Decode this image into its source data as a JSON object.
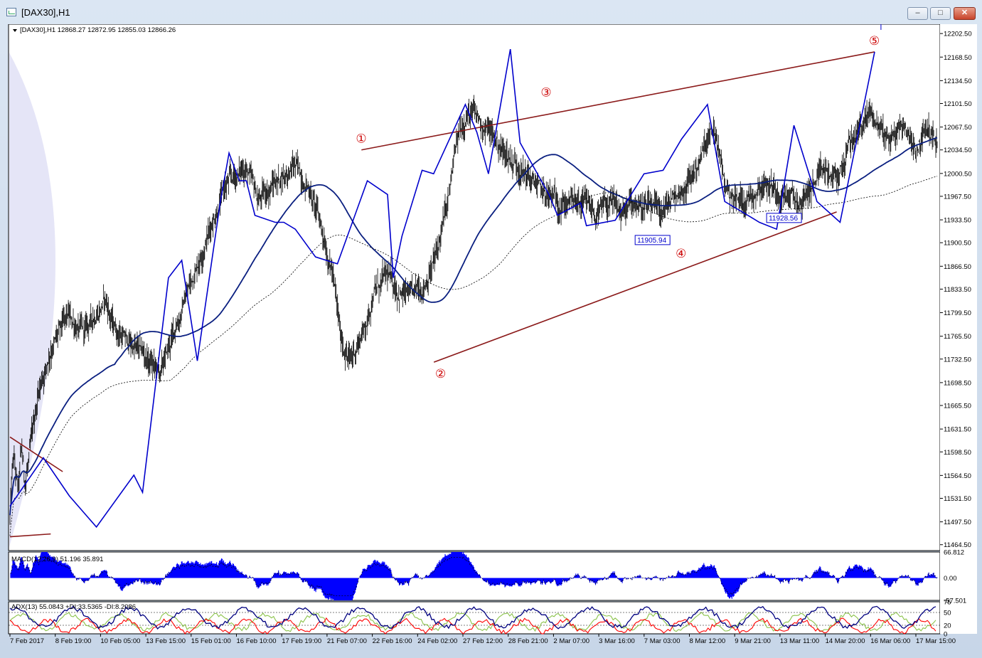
{
  "window": {
    "title": "[DAX30],H1",
    "min_glyph": "‒",
    "max_glyph": "□",
    "close_glyph": "✕"
  },
  "chart_data": {
    "type": "candlestick",
    "symbol_info": "[DAX30],H1  12868.27 12872.95 12855.03 12866.26",
    "y_ticks": [
      "12202.50",
      "12168.50",
      "12134.50",
      "12101.50",
      "12067.50",
      "12034.50",
      "12000.50",
      "11967.50",
      "11933.50",
      "11900.50",
      "11866.50",
      "11833.50",
      "11799.50",
      "11765.50",
      "11732.50",
      "11698.50",
      "11665.50",
      "11631.50",
      "11598.50",
      "11564.50",
      "11531.50",
      "11497.50",
      "11464.50"
    ],
    "x_ticks": [
      "7 Feb 2017",
      "8 Feb 19:00",
      "10 Feb 05:00",
      "13 Feb 15:00",
      "15 Feb 01:00",
      "16 Feb 10:00",
      "17 Feb 19:00",
      "21 Feb 07:00",
      "22 Feb 16:00",
      "24 Feb 02:00",
      "27 Feb 12:00",
      "28 Feb 21:00",
      "2 Mar 07:00",
      "3 Mar 16:00",
      "7 Mar 03:00",
      "8 Mar 12:00",
      "9 Mar 21:00",
      "13 Mar 11:00",
      "14 Mar 20:00",
      "16 Mar 06:00",
      "17 Mar 15:00"
    ],
    "ylim": [
      11456,
      12216
    ],
    "price_path": [
      [
        0,
        11505
      ],
      [
        4,
        11590
      ],
      [
        10,
        11540
      ],
      [
        14,
        11600
      ],
      [
        18,
        11552
      ],
      [
        25,
        11600
      ],
      [
        35,
        11690
      ],
      [
        50,
        11750
      ],
      [
        70,
        11790
      ],
      [
        90,
        11770
      ],
      [
        115,
        11820
      ],
      [
        125,
        11780
      ],
      [
        140,
        11760
      ],
      [
        160,
        11740
      ],
      [
        182,
        11710
      ],
      [
        198,
        11770
      ],
      [
        215,
        11830
      ],
      [
        235,
        11900
      ],
      [
        260,
        11980
      ],
      [
        285,
        12010
      ],
      [
        300,
        11960
      ],
      [
        330,
        12000
      ],
      [
        345,
        12010
      ],
      [
        362,
        11980
      ],
      [
        375,
        11930
      ],
      [
        390,
        11860
      ],
      [
        400,
        11760
      ],
      [
        412,
        11730
      ],
      [
        422,
        11760
      ],
      [
        432,
        11790
      ],
      [
        440,
        11830
      ],
      [
        455,
        11850
      ],
      [
        472,
        11830
      ],
      [
        485,
        11820
      ],
      [
        500,
        11840
      ],
      [
        515,
        11880
      ],
      [
        530,
        11960
      ],
      [
        540,
        12040
      ],
      [
        552,
        12090
      ],
      [
        565,
        12080
      ],
      [
        580,
        12060
      ],
      [
        598,
        12030
      ],
      [
        618,
        12010
      ],
      [
        630,
        11990
      ],
      [
        645,
        11970
      ],
      [
        660,
        11960
      ],
      [
        678,
        11960
      ],
      [
        695,
        11950
      ],
      [
        712,
        11940
      ],
      [
        725,
        11955
      ],
      [
        740,
        11940
      ],
      [
        756,
        11960
      ],
      [
        770,
        11950
      ],
      [
        785,
        11940
      ],
      [
        800,
        11960
      ],
      [
        815,
        11980
      ],
      [
        830,
        12010
      ],
      [
        842,
        12040
      ],
      [
        852,
        12060
      ],
      [
        865,
        11980
      ],
      [
        880,
        11960
      ],
      [
        895,
        11970
      ],
      [
        910,
        11990
      ],
      [
        925,
        11980
      ],
      [
        940,
        11970
      ],
      [
        955,
        11955
      ],
      [
        968,
        11980
      ],
      [
        985,
        12000
      ],
      [
        1000,
        11990
      ],
      [
        1015,
        12040
      ],
      [
        1030,
        12070
      ],
      [
        1040,
        12090
      ],
      [
        1050,
        12070
      ],
      [
        1065,
        12050
      ],
      [
        1080,
        12070
      ],
      [
        1095,
        12040
      ],
      [
        1110,
        12065
      ],
      [
        1121,
        12040
      ]
    ],
    "vertical_dashed_marker": {
      "label": "",
      "x_index": 1055
    },
    "zigzag": [
      [
        0,
        11520
      ],
      [
        58,
        11590
      ],
      [
        103,
        11535
      ],
      [
        150,
        11490
      ],
      [
        215,
        11565
      ],
      [
        230,
        11540
      ],
      [
        275,
        11850
      ],
      [
        298,
        11875
      ],
      [
        325,
        11730
      ],
      [
        365,
        11960
      ],
      [
        380,
        12030
      ],
      [
        398,
        11990
      ],
      [
        410,
        11990
      ],
      [
        425,
        11940
      ],
      [
        460,
        11930
      ],
      [
        475,
        11930
      ],
      [
        495,
        11920
      ],
      [
        530,
        11880
      ],
      [
        568,
        11870
      ],
      [
        620,
        11990
      ],
      [
        655,
        11970
      ],
      [
        665,
        11850
      ],
      [
        680,
        11910
      ],
      [
        715,
        12005
      ],
      [
        735,
        12000
      ],
      [
        790,
        12100
      ],
      [
        810,
        12060
      ],
      [
        830,
        12000
      ],
      [
        868,
        12180
      ],
      [
        885,
        12045
      ],
      [
        935,
        11970
      ],
      [
        950,
        11940
      ],
      [
        990,
        11958
      ],
      [
        1000,
        11925
      ],
      [
        1050,
        11933
      ],
      [
        1100,
        12000
      ],
      [
        1133,
        12005
      ],
      [
        1165,
        12050
      ],
      [
        1210,
        12100
      ],
      [
        1240,
        11960
      ],
      [
        1290,
        11935
      ],
      [
        1300,
        11930
      ],
      [
        1330,
        11920
      ],
      [
        1360,
        12070
      ],
      [
        1390,
        11990
      ],
      [
        1400,
        11960
      ],
      [
        1440,
        11930
      ],
      [
        1500,
        12176
      ]
    ],
    "zigzag_markers": [
      {
        "label": "①",
        "x": 500,
        "price": 12034.5,
        "series": "wave"
      },
      {
        "label": "②",
        "x": 613,
        "price": 11732.5,
        "series": "wave"
      },
      {
        "label": "③",
        "x": 763,
        "price": 12101.5,
        "series": "wave"
      },
      {
        "label": "④",
        "x": 955,
        "price": 11905.94,
        "series": "wave"
      },
      {
        "label": "⑤",
        "x": 1230,
        "price": 12176,
        "series": "wave"
      }
    ],
    "price_boxes": [
      "11905.94",
      "11928.56"
    ],
    "macd": {
      "label": "MACD(12,26,9) 51.196 35.891",
      "y_ticks": [
        "66.812",
        "0.00",
        "-57.501"
      ],
      "ylim": [
        -57.501,
        66.812
      ]
    },
    "adx": {
      "label": "ADX(13) 55.0843 +DI:33.5365 -DI:8.2086",
      "y_ticks": [
        "75",
        "50",
        "20",
        "0"
      ],
      "ylim": [
        0,
        75
      ]
    },
    "colors": {
      "candles": "#000000",
      "zigzag": "#0000cc",
      "ma_fast": "#0a1f80",
      "ma_slow": "#000000",
      "channel": "#8b1a1a",
      "marker": "#cc0000",
      "macd_hist": "#0000ff",
      "adx": "#000080",
      "plus_di": "#8bc34a",
      "minus_di": "#ff0000",
      "session_shade": "#dcdcf4"
    },
    "grid": false
  }
}
